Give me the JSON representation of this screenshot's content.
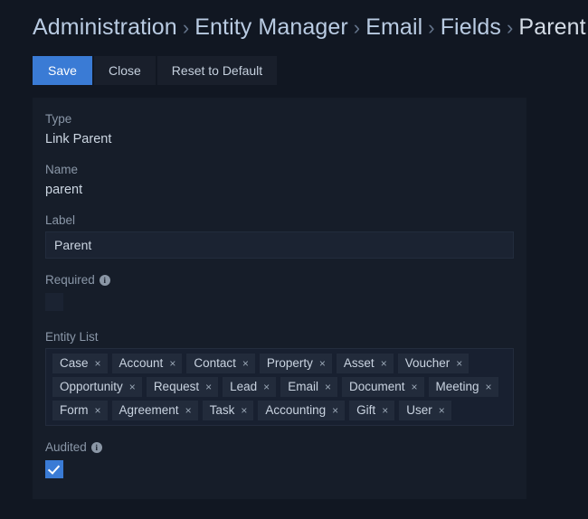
{
  "breadcrumb": {
    "separator": "›",
    "items": [
      {
        "label": "Administration",
        "current": false
      },
      {
        "label": "Entity Manager",
        "current": false
      },
      {
        "label": "Email",
        "current": false
      },
      {
        "label": "Fields",
        "current": false
      },
      {
        "label": "Parent",
        "current": true
      }
    ]
  },
  "toolbar": {
    "save_label": "Save",
    "close_label": "Close",
    "reset_label": "Reset to Default"
  },
  "form": {
    "type": {
      "label": "Type",
      "value": "Link Parent"
    },
    "name": {
      "label": "Name",
      "value": "parent"
    },
    "field_label": {
      "label": "Label",
      "value": "Parent",
      "placeholder": ""
    },
    "required": {
      "label": "Required",
      "checked": false,
      "info_icon": "info-icon",
      "info_glyph": "i"
    },
    "entity_list": {
      "label": "Entity List",
      "remove_glyph": "×",
      "tags": [
        "Case",
        "Account",
        "Contact",
        "Property",
        "Asset",
        "Voucher",
        "Opportunity",
        "Request",
        "Lead",
        "Email",
        "Document",
        "Meeting",
        "Form",
        "Agreement",
        "Task",
        "Accounting",
        "Gift",
        "User"
      ]
    },
    "audited": {
      "label": "Audited",
      "checked": true,
      "info_icon": "info-icon",
      "info_glyph": "i"
    }
  },
  "colors": {
    "page_background": "#111722",
    "panel_background": "#161d29",
    "accent_blue": "#3a7bd5",
    "tag_background": "#222b3b",
    "input_background": "#1b2332",
    "muted_text": "#8a97a8",
    "body_text": "#ccd6e2"
  }
}
